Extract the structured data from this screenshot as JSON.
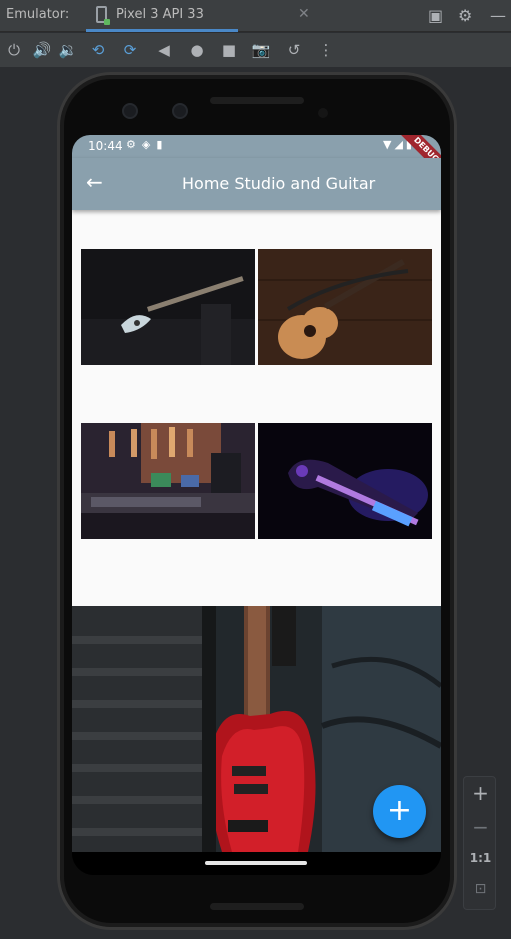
{
  "ide": {
    "label": "Emulator:",
    "tab_title": "Pixel 3 API 33",
    "tab_close": "✕"
  },
  "toolbar_icons": [
    "power-icon",
    "volume-up-icon",
    "volume-down-icon",
    "rotate-left-icon",
    "rotate-right-icon",
    "back-icon",
    "home-icon",
    "overview-icon",
    "screenshot-icon",
    "snapshot-icon",
    "more-icon"
  ],
  "statusbar": {
    "time": "10:44",
    "debug_label": "DEBUG"
  },
  "appbar": {
    "title": "Home Studio and Guitar",
    "back_symbol": "←"
  },
  "grid_images": [
    {
      "name": "guitar-dark-thumbnail"
    },
    {
      "name": "acoustic-guitar-thumbnail"
    },
    {
      "name": "home-studio-thumbnail"
    },
    {
      "name": "neon-guitar-thumbnail"
    }
  ],
  "hero_image": "red-bass-guitar-photo",
  "fab": {
    "symbol": "+"
  },
  "zoom": {
    "plus": "+",
    "minus": "−",
    "ratio": "1:1"
  },
  "colors": {
    "appbar": "#8aa0ad",
    "fab": "#2196f3",
    "ide_accent": "#4a88c7"
  }
}
